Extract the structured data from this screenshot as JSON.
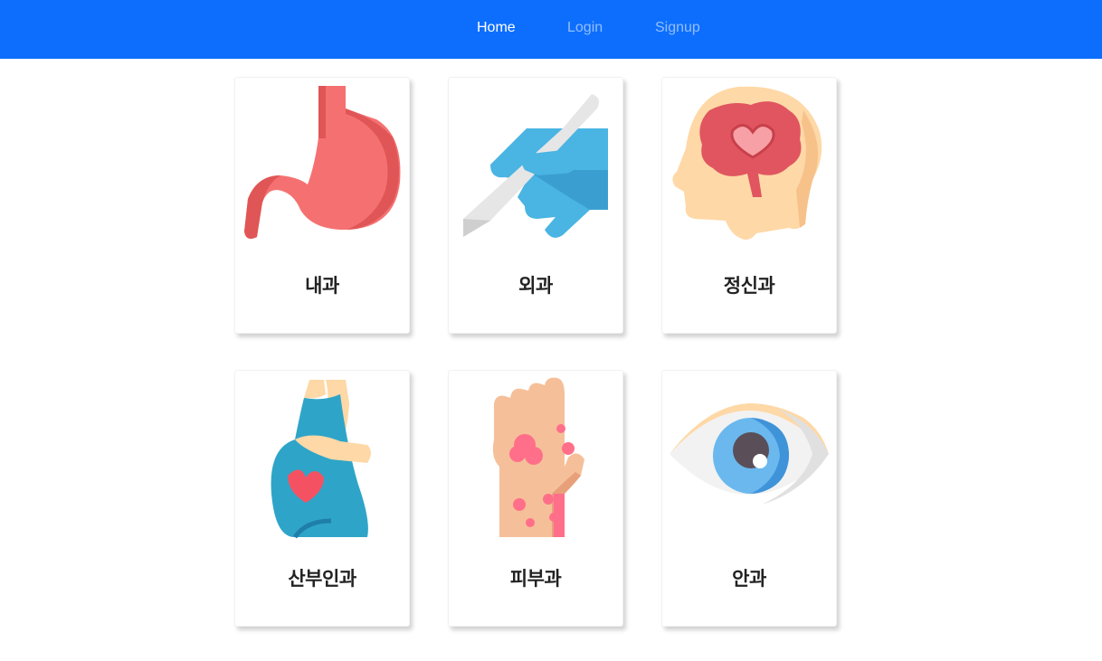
{
  "nav": {
    "home": "Home",
    "login": "Login",
    "signup": "Signup"
  },
  "departments": [
    {
      "label": "내과",
      "icon": "stomach-icon"
    },
    {
      "label": "외과",
      "icon": "scalpel-glove-icon"
    },
    {
      "label": "정신과",
      "icon": "brain-head-icon"
    },
    {
      "label": "산부인과",
      "icon": "pregnant-woman-icon"
    },
    {
      "label": "피부과",
      "icon": "skin-rash-hand-icon"
    },
    {
      "label": "안과",
      "icon": "eye-icon"
    }
  ],
  "colors": {
    "navbar": "#0d6efd",
    "nav_active": "#ffffff",
    "nav_inactive": "rgba(255,255,255,0.55)"
  }
}
